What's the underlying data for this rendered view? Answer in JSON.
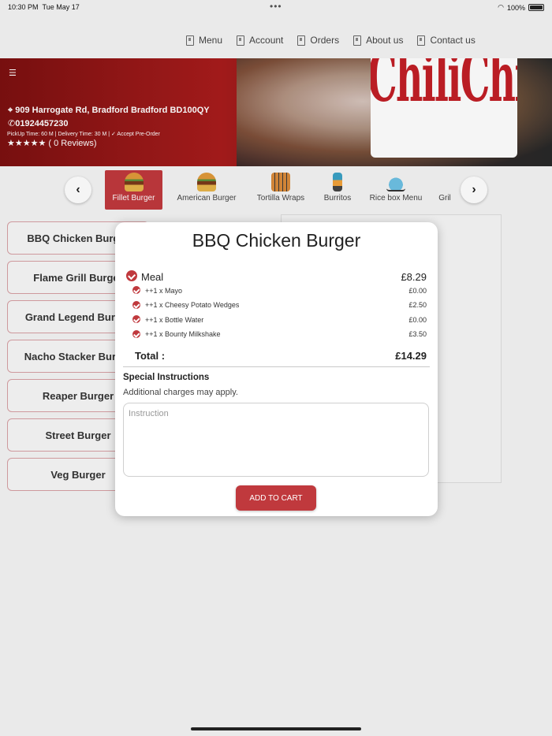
{
  "status": {
    "time": "10:30 PM",
    "date": "Tue May 17",
    "battery": "100%"
  },
  "nav": [
    {
      "label": "Menu"
    },
    {
      "label": "Account"
    },
    {
      "label": "Orders"
    },
    {
      "label": "About us"
    },
    {
      "label": "Contact us"
    }
  ],
  "hero": {
    "address": "909 Harrogate Rd, Bradford Bradford BD100QY",
    "phone": "01924457230",
    "times": "PickUp Time: 60 M | Delivery Time: 30 M | ✓ Accept Pre-Order",
    "stars": "★★★★★",
    "reviews": "( 0 Reviews)",
    "logo_text": "ChiliChick's"
  },
  "categories": [
    {
      "label": "Fillet Burger",
      "active": true
    },
    {
      "label": "American Burger"
    },
    {
      "label": "Tortilla Wraps"
    },
    {
      "label": "Burritos"
    },
    {
      "label": "Rice box Menu"
    },
    {
      "label": "Gril"
    }
  ],
  "products": [
    "BBQ Chicken Burger",
    "Flame Grill Burger",
    "Grand Legend Burger",
    "Nacho Stacker Burger",
    "Reaper Burger",
    "Street Burger",
    "Veg Burger"
  ],
  "modal": {
    "title": "BBQ Chicken Burger",
    "meal_label": "Meal",
    "meal_price": "£8.29",
    "addons": [
      {
        "label": "++1 x Mayo",
        "price": "£0.00"
      },
      {
        "label": "++1 x Cheesy Potato Wedges",
        "price": "£2.50"
      },
      {
        "label": "++1 x Bottle Water",
        "price": "£0.00"
      },
      {
        "label": "++1 x Bounty Milkshake",
        "price": "£3.50"
      }
    ],
    "total_label": "Total :",
    "total_value": "£14.29",
    "special_title": "Special Instructions",
    "special_sub": "Additional charges may apply.",
    "instruction_placeholder": "Instruction",
    "add_to_cart": "ADD TO CART"
  },
  "colors": {
    "accent": "#c0393d",
    "hero_red": "#a81c1c"
  }
}
